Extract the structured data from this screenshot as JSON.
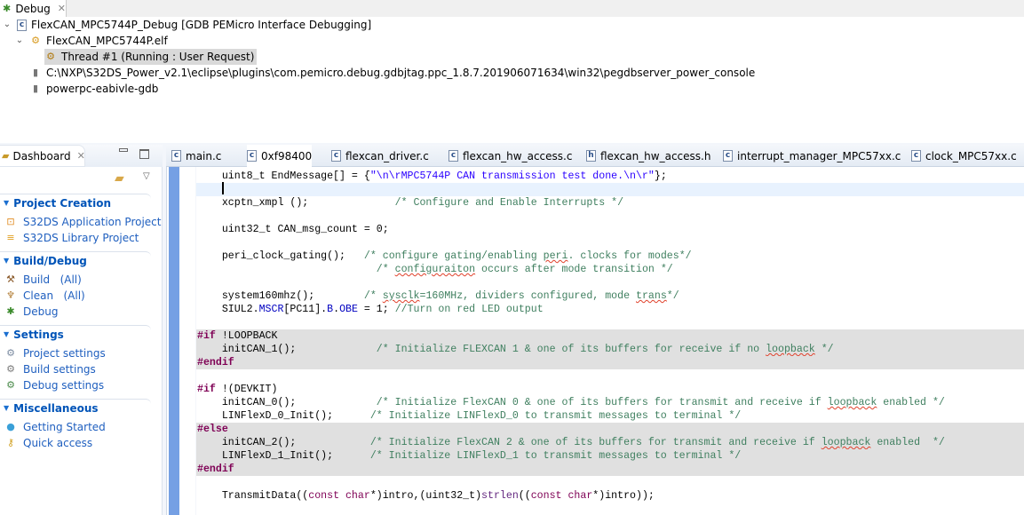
{
  "debug_view": {
    "tab_label": "Debug",
    "tree": [
      {
        "label": "FlexCAN_MPC5744P_Debug [GDB PEMicro Interface Debugging]",
        "icon": "launch-config-icon"
      },
      {
        "label": "FlexCAN_MPC5744P.elf",
        "icon": "process-icon"
      },
      {
        "label": "Thread #1 (Running : User Request)",
        "icon": "thread-running-icon"
      },
      {
        "label": "C:\\NXP\\S32DS_Power_v2.1\\eclipse\\plugins\\com.pemicro.debug.gdbjtag.ppc_1.8.7.201906071634\\win32\\pegdbserver_power_console",
        "icon": "server-process-icon"
      },
      {
        "label": "powerpc-eabivle-gdb",
        "icon": "gdb-process-icon"
      }
    ]
  },
  "dashboard": {
    "tab_label": "Dashboard",
    "sections": [
      {
        "title": "Project Creation",
        "items": [
          {
            "label": "S32DS Application Project"
          },
          {
            "label": "S32DS Library Project"
          }
        ]
      },
      {
        "title": "Build/Debug",
        "items": [
          {
            "label": "Build   (All)"
          },
          {
            "label": "Clean   (All)"
          },
          {
            "label": "Debug"
          }
        ]
      },
      {
        "title": "Settings",
        "items": [
          {
            "label": "Project settings"
          },
          {
            "label": "Build settings"
          },
          {
            "label": "Debug settings"
          }
        ]
      },
      {
        "title": "Miscellaneous",
        "items": [
          {
            "label": "Getting Started"
          },
          {
            "label": "Quick access"
          }
        ]
      }
    ]
  },
  "editor": {
    "tabs": [
      {
        "label": "main.c",
        "type": "c"
      },
      {
        "label": "0xf98400",
        "type": "c"
      },
      {
        "label": "flexcan_driver.c",
        "type": "c"
      },
      {
        "label": "flexcan_hw_access.c",
        "type": "c"
      },
      {
        "label": "flexcan_hw_access.h",
        "type": "h"
      },
      {
        "label": "interrupt_manager_MPC57xx.c",
        "type": "c"
      },
      {
        "label": "clock_MPC57xx.c",
        "type": "c"
      }
    ],
    "lines": [
      {
        "bg": "",
        "tokens": [
          [
            "",
            "    uint8_t EndMessage[] = {"
          ],
          [
            "str",
            "\"\\n\\rMPC5744P CAN transmission test done.\\n\\r\""
          ],
          [
            "",
            "};"
          ]
        ]
      },
      {
        "bg": "cur",
        "tokens": []
      },
      {
        "bg": "",
        "tokens": [
          [
            "",
            "    xcptn_xmpl ();              "
          ],
          [
            "cm",
            "/* Configure and Enable Interrupts */"
          ]
        ]
      },
      {
        "bg": "",
        "tokens": []
      },
      {
        "bg": "",
        "tokens": [
          [
            "",
            "    uint32_t CAN_msg_count = 0;"
          ]
        ]
      },
      {
        "bg": "",
        "tokens": []
      },
      {
        "bg": "",
        "tokens": [
          [
            "",
            "    peri_clock_gating();   "
          ],
          [
            "cm",
            "/* configure gating/enabling "
          ],
          [
            "err",
            "peri"
          ],
          [
            "cm",
            ". clocks for modes*/"
          ]
        ]
      },
      {
        "bg": "",
        "tokens": [
          [
            "",
            "                             "
          ],
          [
            "cm",
            "/* "
          ],
          [
            "err",
            "configuraiton"
          ],
          [
            "cm",
            " occurs after mode transition */"
          ]
        ]
      },
      {
        "bg": "",
        "tokens": []
      },
      {
        "bg": "",
        "tokens": [
          [
            "",
            "    system160mhz();        "
          ],
          [
            "cm",
            "/* "
          ],
          [
            "err",
            "sysclk"
          ],
          [
            "cm",
            "=160MHz, dividers configured, mode "
          ],
          [
            "err",
            "trans"
          ],
          [
            "cm",
            "*/"
          ]
        ]
      },
      {
        "bg": "",
        "tokens": [
          [
            "",
            "    SIUL2."
          ],
          [
            "fld",
            "MSCR"
          ],
          [
            "",
            "[PC11]."
          ],
          [
            "fld",
            "B"
          ],
          [
            "",
            "."
          ],
          [
            "fld",
            "OBE"
          ],
          [
            "",
            " = 1; "
          ],
          [
            "cm",
            "//Turn on red LED output"
          ]
        ]
      },
      {
        "bg": "",
        "tokens": []
      },
      {
        "bg": "inact",
        "tokens": [
          [
            "pre",
            "#if"
          ],
          [
            "",
            " !LOOPBACK"
          ]
        ]
      },
      {
        "bg": "inact",
        "tokens": [
          [
            "",
            "    initCAN_1();             "
          ],
          [
            "cm",
            "/* Initialize FLEXCAN 1 & one of its buffers for receive if no "
          ],
          [
            "err",
            "loopback"
          ],
          [
            "cm",
            " */"
          ]
        ]
      },
      {
        "bg": "inact",
        "tokens": [
          [
            "pre",
            "#endif"
          ]
        ]
      },
      {
        "bg": "",
        "tokens": []
      },
      {
        "bg": "",
        "tokens": [
          [
            "pre",
            "#if"
          ],
          [
            "",
            " !(DEVKIT)"
          ]
        ]
      },
      {
        "bg": "",
        "tokens": [
          [
            "",
            "    initCAN_0();             "
          ],
          [
            "cm",
            "/* Initialize FlexCAN 0 & one of its buffers for transmit and receive if "
          ],
          [
            "err",
            "loopback"
          ],
          [
            "cm",
            " enabled */"
          ]
        ]
      },
      {
        "bg": "",
        "tokens": [
          [
            "",
            "    LINFlexD_0_Init();      "
          ],
          [
            "cm",
            "/* Initialize LINFlexD_0 to transmit messages to terminal */"
          ]
        ]
      },
      {
        "bg": "inact",
        "tokens": [
          [
            "pre",
            "#else"
          ]
        ]
      },
      {
        "bg": "inact",
        "tokens": [
          [
            "",
            "    initCAN_2();            "
          ],
          [
            "cm",
            "/* Initialize FlexCAN 2 & one of its buffers for transmit and receive if "
          ],
          [
            "err",
            "loopback"
          ],
          [
            "cm",
            " enabled  */"
          ]
        ]
      },
      {
        "bg": "inact",
        "tokens": [
          [
            "",
            "    LINFlexD_1_Init();      "
          ],
          [
            "cm",
            "/* Initialize LINFlexD_1 to transmit messages to terminal */"
          ]
        ]
      },
      {
        "bg": "inact",
        "tokens": [
          [
            "pre",
            "#endif"
          ]
        ]
      },
      {
        "bg": "",
        "tokens": []
      },
      {
        "bg": "",
        "tokens": [
          [
            "",
            "    TransmitData(("
          ],
          [
            "kw",
            "const char"
          ],
          [
            "",
            "*)intro,(uint32_t)"
          ],
          [
            "fn",
            "strlen"
          ],
          [
            "",
            "(("
          ],
          [
            "kw",
            "const char"
          ],
          [
            "",
            "*)intro));"
          ]
        ]
      }
    ]
  }
}
